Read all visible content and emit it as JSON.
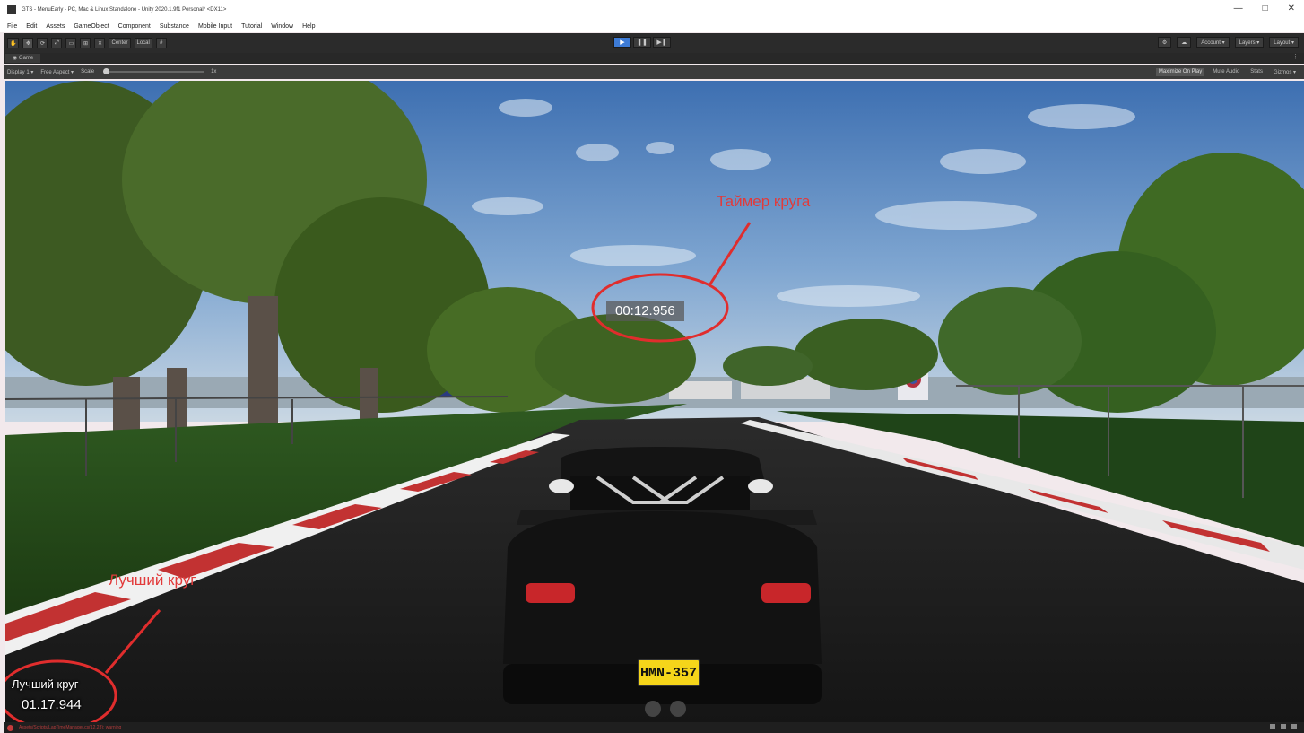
{
  "window": {
    "title": "GTS - MenuEarly - PC, Mac & Linux Standalone - Unity 2020.1.9f1 Personal* <DX11>",
    "controls": [
      "—",
      "□",
      "✕"
    ]
  },
  "menu": [
    "File",
    "Edit",
    "Assets",
    "GameObject",
    "Component",
    "Substance",
    "Mobile Input",
    "Tutorial",
    "Window",
    "Help"
  ],
  "toolbar": {
    "pivot_label": "Center",
    "space_label": "Local",
    "play_icon": "▶",
    "pause_icon": "❚❚",
    "step_icon": "▶❚",
    "account_label": "Account ▾",
    "layers_label": "Layers ▾",
    "layout_label": "Layout ▾"
  },
  "game_view": {
    "tab_label": "Game",
    "display_label": "Display 1 ▾",
    "aspect_label": "Free Aspect ▾",
    "scale_label": "Scale",
    "scale_value": "1x",
    "toggles": [
      "Maximize On Play",
      "Mute Audio",
      "Stats",
      "Gizmos ▾"
    ]
  },
  "hud": {
    "lap_timer": "00:12.956",
    "best_lap_title": "Лучший круг",
    "best_lap_value": "01.17.944",
    "license_plate": "HMN-357"
  },
  "annotations": {
    "lap_timer_label": "Таймер круга",
    "best_lap_label": "Лучший круг",
    "color": "#e23a3a"
  },
  "status_bar": {
    "error_text": "Assets/Scripts/LapTimeManager.cs(12,23): warning"
  }
}
